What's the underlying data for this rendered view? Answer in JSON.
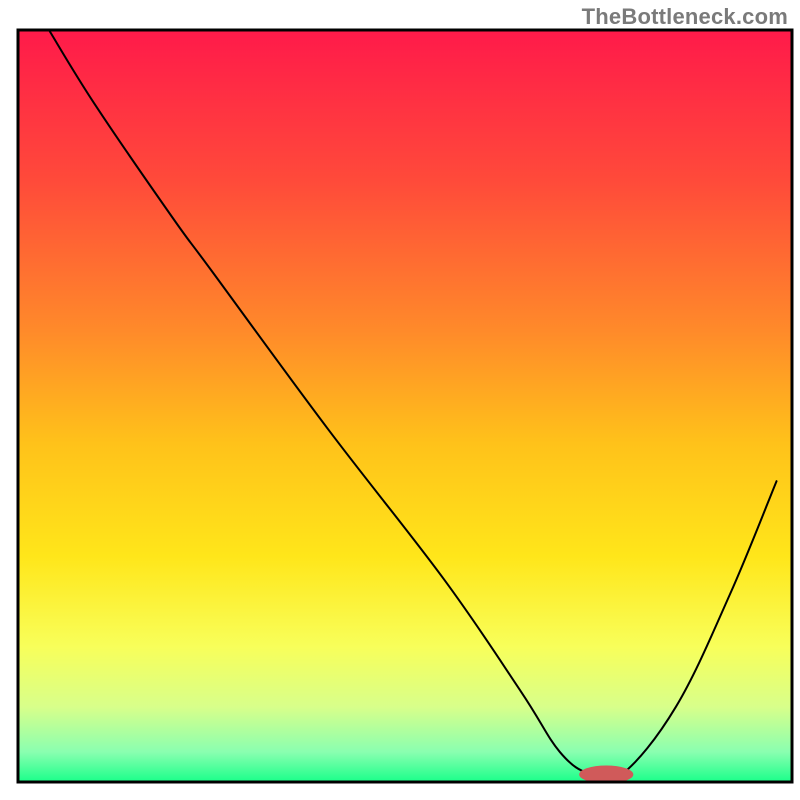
{
  "watermark": "TheBottleneck.com",
  "chart_data": {
    "type": "line",
    "title": "",
    "xlabel": "",
    "ylabel": "",
    "xlim": [
      0,
      100
    ],
    "ylim": [
      0,
      100
    ],
    "grid": false,
    "legend": false,
    "gradient_stops": [
      {
        "offset": 0.0,
        "color": "#ff1a4a"
      },
      {
        "offset": 0.2,
        "color": "#ff4a3a"
      },
      {
        "offset": 0.4,
        "color": "#ff8a2a"
      },
      {
        "offset": 0.55,
        "color": "#ffc21a"
      },
      {
        "offset": 0.7,
        "color": "#ffe61a"
      },
      {
        "offset": 0.82,
        "color": "#f8ff5a"
      },
      {
        "offset": 0.9,
        "color": "#d8ff8a"
      },
      {
        "offset": 0.96,
        "color": "#8affb0"
      },
      {
        "offset": 1.0,
        "color": "#1aff8a"
      }
    ],
    "series": [
      {
        "name": "bottleneck-curve",
        "stroke": "#000000",
        "stroke_width": 2,
        "x": [
          4,
          10,
          20,
          25,
          40,
          55,
          65,
          70,
          74,
          78,
          85,
          92,
          98
        ],
        "y": [
          100,
          90,
          75,
          68,
          47,
          27,
          12,
          4,
          1,
          1,
          10,
          25,
          40
        ]
      }
    ],
    "marker": {
      "name": "optimal-marker",
      "cx": 76,
      "cy": 1,
      "rx": 3.5,
      "ry": 1.2,
      "fill": "#d05a5a"
    },
    "axes": {
      "frame_stroke": "#000000",
      "frame_stroke_width": 3
    }
  }
}
